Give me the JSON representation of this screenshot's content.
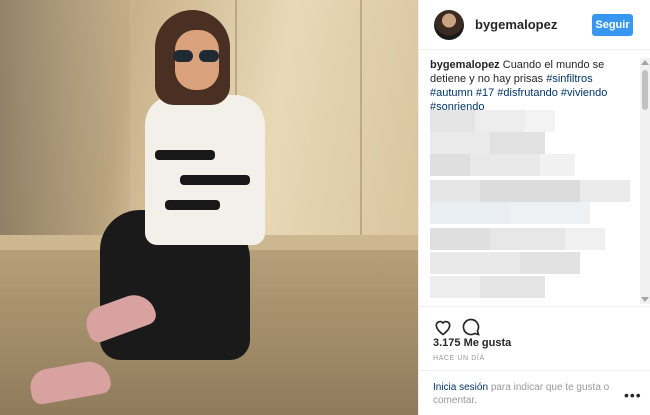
{
  "post": {
    "username": "bygemalopez",
    "follow_label": "Seguir"
  },
  "caption": {
    "username": "bygemalopez",
    "text": "Cuando el mundo se detiene y no hay prisas",
    "hashtags": [
      "#sinfiltros",
      "#autumn",
      "#17",
      "#disfrutando",
      "#viviendo",
      "#sonriendo"
    ]
  },
  "stats": {
    "likes": "3.175 Me gusta",
    "time_ago": "HACE UN DÍA"
  },
  "login_prompt": {
    "link": "Inicia sesión",
    "text": "para indicar que te gusta o comentar."
  },
  "icons": {
    "like": "heart-icon",
    "comment": "comment-icon",
    "more": "more-options-icon"
  },
  "colors": {
    "accent": "#3897f0",
    "link": "#003569",
    "muted": "#999999"
  }
}
